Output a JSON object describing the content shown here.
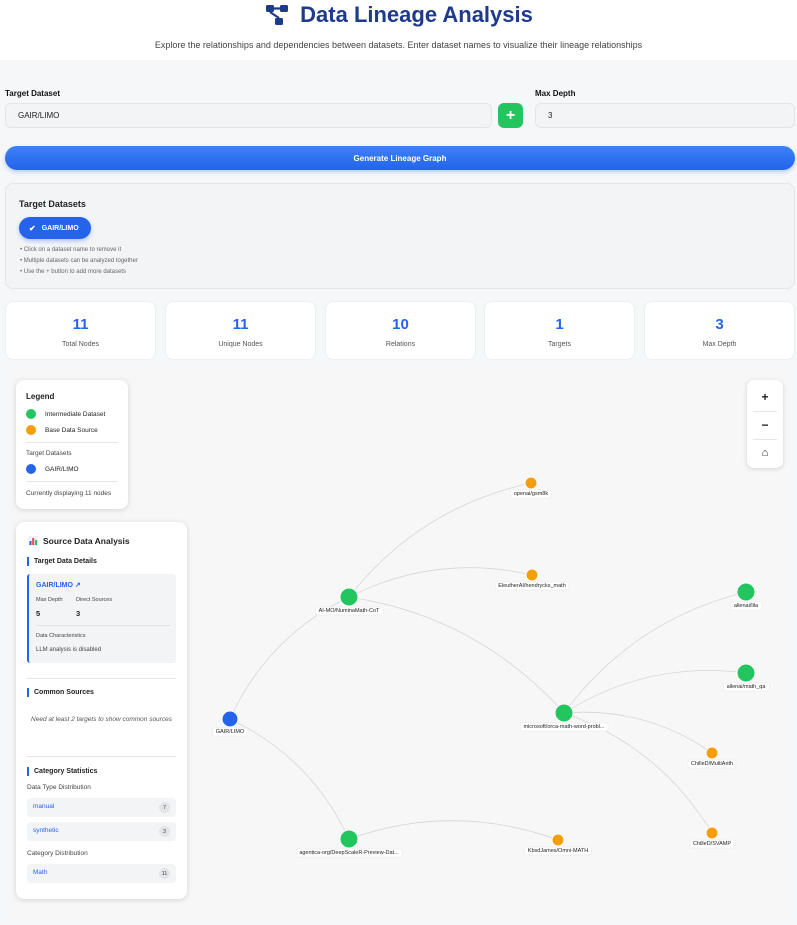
{
  "header": {
    "title": "Data Lineage Analysis",
    "subtitle": "Explore the relationships and dependencies between datasets. Enter dataset names to visualize their lineage relationships",
    "title_color": "#1e3a8a"
  },
  "form": {
    "target_label": "Target Dataset",
    "target_value": "GAIR/LIMO",
    "add_button": "+",
    "depth_label": "Max Depth",
    "depth_value": "3",
    "generate_button": "Generate Lineage Graph"
  },
  "targets_panel": {
    "title": "Target Datasets",
    "chip": "GAIR/LIMO",
    "tips": [
      "• Click on a dataset name to remove it",
      "• Multiple datasets can be analyzed together",
      "• Use the + button to add more datasets"
    ]
  },
  "stats": [
    {
      "value": "11",
      "label": "Total Nodes"
    },
    {
      "value": "11",
      "label": "Unique Nodes"
    },
    {
      "value": "10",
      "label": "Relations"
    },
    {
      "value": "1",
      "label": "Targets"
    },
    {
      "value": "3",
      "label": "Max Depth"
    }
  ],
  "legend": {
    "title": "Legend",
    "intermediate": "Intermediate Dataset",
    "base": "Base Data Source",
    "targets_heading": "Target Datasets",
    "target": "GAIR/LIMO",
    "footer": "Currently displaying 11 nodes"
  },
  "colors": {
    "intermediate": "#22c55e",
    "base": "#f59e0b",
    "target": "#2563eb",
    "accent": "#2563eb"
  },
  "source_analysis": {
    "title": "Source Data Analysis",
    "target_details_heading": "Target Data Details",
    "dataset_link": "GAIR/LIMO ↗",
    "max_depth_label": "Max Depth",
    "max_depth_value": "5",
    "direct_sources_label": "Direct Sources",
    "direct_sources_value": "3",
    "characteristics_label": "Data Characteristics",
    "characteristics_value": "LLM analysis is disabled",
    "common_heading": "Common Sources",
    "common_note": "Need at least 2 targets to show common sources",
    "category_heading": "Category Statistics",
    "type_dist_label": "Data Type Distribution",
    "types": [
      {
        "name": "manual",
        "count": "7"
      },
      {
        "name": "synthetic",
        "count": "3"
      }
    ],
    "cat_dist_label": "Category Distribution",
    "categories": [
      {
        "name": "Math",
        "count": "11"
      }
    ]
  },
  "zoom": {
    "in": "+",
    "out": "−",
    "home": "⌂"
  },
  "graph": {
    "nodes": [
      {
        "id": "target",
        "label": "GAIR/LIMO",
        "type": "target"
      },
      {
        "id": "numina",
        "label": "AI-MO/NuminaMath-CoT",
        "type": "intermediate"
      },
      {
        "id": "deepscaler",
        "label": "agentica-org/DeepScaleR-Preview-Dat...",
        "type": "intermediate"
      },
      {
        "id": "orca",
        "label": "microsoft/orca-math-word-probl...",
        "type": "intermediate"
      },
      {
        "id": "gsm8k",
        "label": "openai/gsm8k",
        "type": "base"
      },
      {
        "id": "hendrycks",
        "label": "EleutherAI/hendrycks_math",
        "type": "base"
      },
      {
        "id": "lila",
        "label": "allenai/lila",
        "type": "intermediate"
      },
      {
        "id": "mathqa",
        "label": "allenai/math_qa",
        "type": "intermediate"
      },
      {
        "id": "multiarith",
        "label": "ChilleD/MultiArith",
        "type": "base"
      },
      {
        "id": "svamp",
        "label": "ChilleD/SVAMP",
        "type": "base"
      },
      {
        "id": "omni",
        "label": "KbsdJames/Omni-MATH",
        "type": "base"
      }
    ],
    "edges": [
      [
        "target",
        "numina"
      ],
      [
        "target",
        "deepscaler"
      ],
      [
        "numina",
        "gsm8k"
      ],
      [
        "numina",
        "hendrycks"
      ],
      [
        "numina",
        "orca"
      ],
      [
        "deepscaler",
        "omni"
      ],
      [
        "orca",
        "lila"
      ],
      [
        "orca",
        "mathqa"
      ],
      [
        "orca",
        "multiarith"
      ],
      [
        "orca",
        "svamp"
      ]
    ]
  }
}
